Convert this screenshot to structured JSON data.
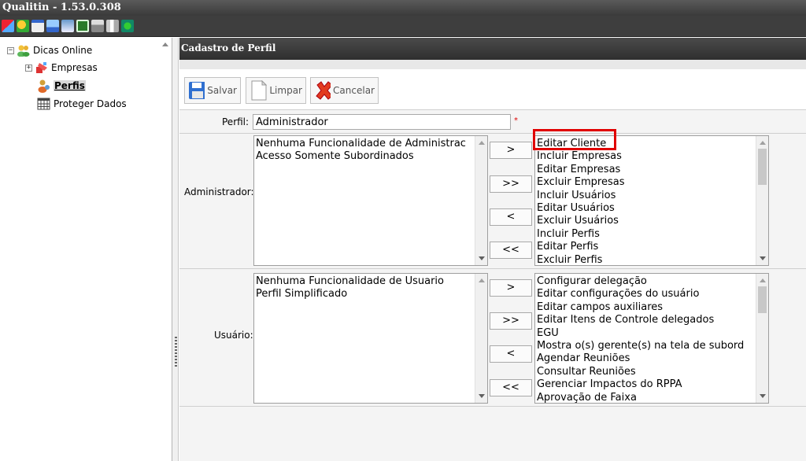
{
  "window": {
    "title": "Qualitin - 1.53.0.308"
  },
  "toolbar": {
    "icons": [
      "brush-icon",
      "users-icon",
      "calendar-icon",
      "chart-icon",
      "report-icon",
      "excel-icon",
      "print-icon",
      "books-icon",
      "refresh-icon"
    ]
  },
  "tree": {
    "root": "Dicas Online",
    "items": [
      {
        "label": "Empresas"
      },
      {
        "label": "Perfis"
      },
      {
        "label": "Proteger Dados"
      }
    ]
  },
  "panel": {
    "title": "Cadastro de Perfil"
  },
  "buttons": {
    "save": "Salvar",
    "clear": "Limpar",
    "cancel": "Cancelar"
  },
  "form": {
    "perfil_label": "Perfil:",
    "perfil_value": "Administrador",
    "required_mark": "*",
    "admin_label": "Administrador:",
    "user_label": "Usuário:"
  },
  "admin": {
    "assigned": [
      "Nenhuma Funcionalidade de Administrac",
      "Acesso Somente Subordinados"
    ],
    "available": [
      "Editar Cliente",
      "Incluir Empresas",
      "Editar Empresas",
      "Excluir Empresas",
      "Incluir Usuários",
      "Editar Usuários",
      "Excluir Usuários",
      "Incluir Perfis",
      "Editar Perfis",
      "Excluir Perfis"
    ]
  },
  "user": {
    "assigned": [
      "Nenhuma Funcionalidade de Usuario",
      "Perfil Simplificado"
    ],
    "available": [
      "Configurar delegação",
      "Editar configurações do usuário",
      "Editar campos auxiliares",
      "Editar Itens de Controle delegados",
      "EGU",
      "Mostra o(s) gerente(s) na tela de subord",
      "Agendar Reuniões",
      "Consultar Reuniões",
      "Gerenciar Impactos do RPPA",
      "Aprovação de Faixa"
    ]
  },
  "move_buttons": {
    "add_one": ">",
    "add_all": ">>",
    "remove_one": "<",
    "remove_all": "<<"
  },
  "colors": {
    "highlight": "#e00000",
    "header": "#3a3a3a"
  }
}
